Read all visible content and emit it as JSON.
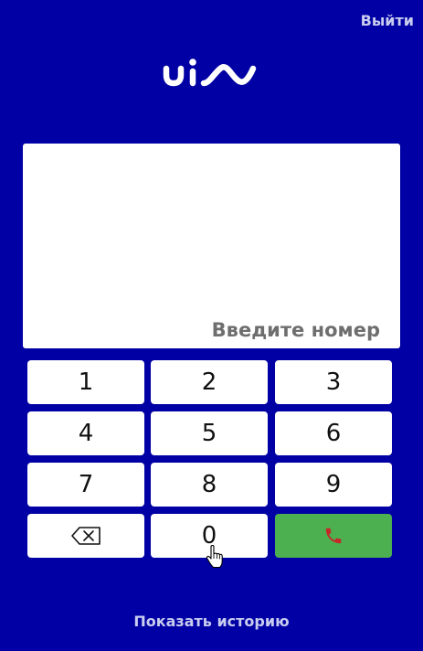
{
  "header": {
    "logout_label": "Выйти"
  },
  "logo": {
    "icon": "uis-logo"
  },
  "display": {
    "placeholder": "Введите номер"
  },
  "keypad": {
    "keys": [
      "1",
      "2",
      "3",
      "4",
      "5",
      "6",
      "7",
      "8",
      "9"
    ],
    "zero": "0",
    "backspace_icon": "backspace-icon",
    "call_icon": "phone-icon"
  },
  "footer": {
    "history_label": "Показать историю"
  },
  "colors": {
    "background": "#0000A4",
    "call_button": "#4CAF50",
    "call_icon": "#C62828",
    "link_text": "#C9CDEF"
  }
}
